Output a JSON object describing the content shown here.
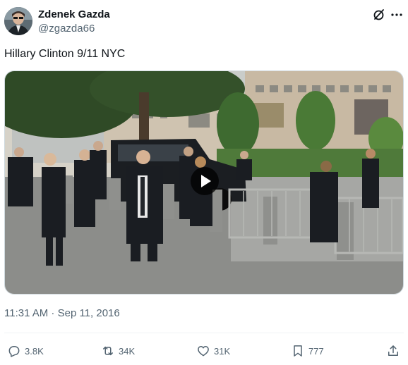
{
  "author": {
    "name": "Zdenek Gazda",
    "handle": "@zgazda66",
    "avatar_icon": "user-avatar"
  },
  "tweet": {
    "text": "Hillary Clinton 9/11 NYC",
    "timestamp": "11:31 AM · Sep 11, 2016"
  },
  "media": {
    "type": "video",
    "play_icon": "play-icon"
  },
  "actions": {
    "reply_count": "3.8K",
    "retweet_count": "34K",
    "like_count": "31K",
    "bookmark_count": "777"
  },
  "colors": {
    "text_primary": "#0f1419",
    "text_secondary": "#536471",
    "border": "#cfd9de"
  }
}
